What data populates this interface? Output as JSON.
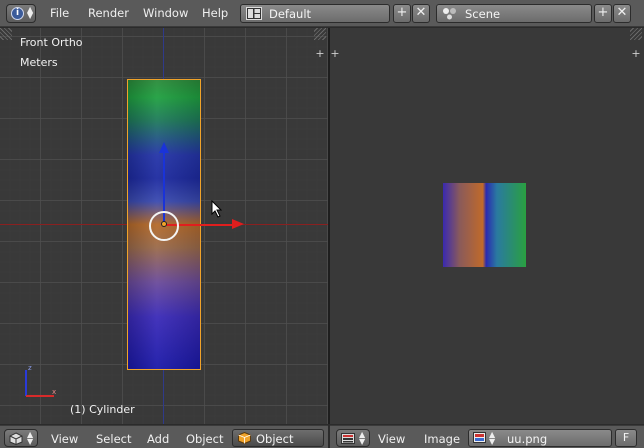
{
  "topbar": {
    "menus": [
      "File",
      "Render",
      "Window",
      "Help"
    ],
    "screen_layout": "Default",
    "scene": "Scene"
  },
  "view3d": {
    "view_name": "Front Ortho",
    "units": "Meters",
    "object_label": "(1) Cylinder",
    "header": {
      "menus": [
        "View",
        "Select",
        "Add",
        "Object"
      ],
      "mode": "Object Mode"
    }
  },
  "image_editor": {
    "header": {
      "menus": [
        "View",
        "Image"
      ],
      "image_name": "uu.png",
      "fake_user": "F"
    }
  },
  "colors": {
    "selection_outline": "#f0a32a",
    "x_axis": "#e01e1e",
    "z_axis": "#1a33d8"
  },
  "icons": [
    "info-icon",
    "screen-layout-icon",
    "scene-icon",
    "add-icon",
    "close-icon",
    "cube-icon",
    "image-icon",
    "cursor-icon"
  ]
}
